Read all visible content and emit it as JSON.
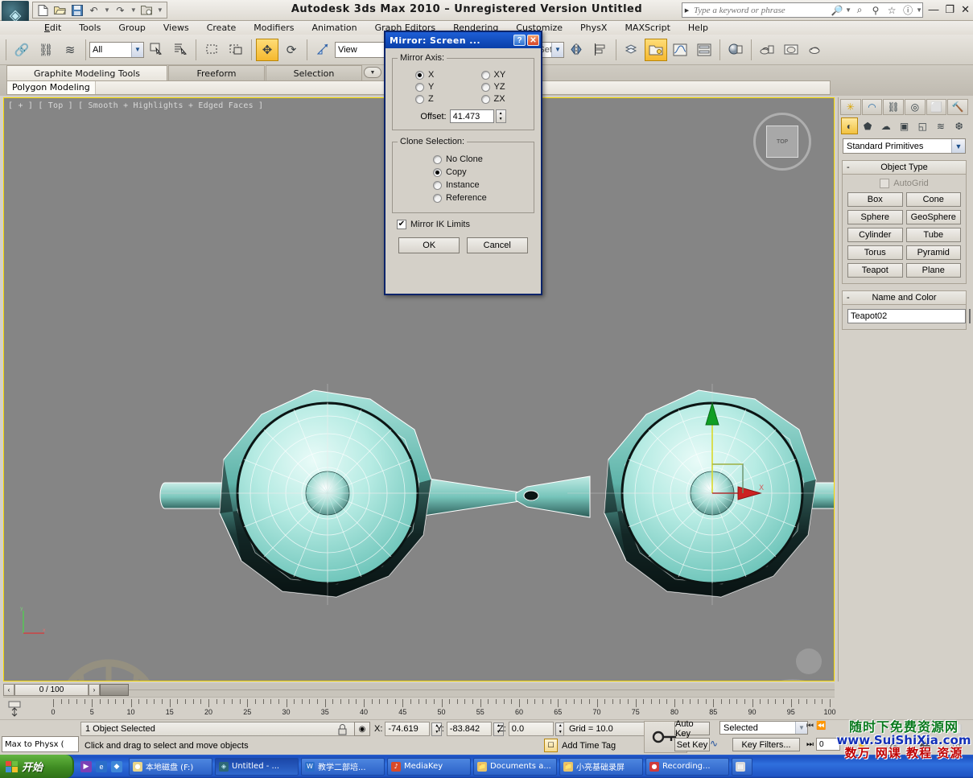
{
  "titlebar": {
    "app_title": "Autodesk 3ds Max  2010  – Unregistered Version  Untitled",
    "logo": "max-logo",
    "quick_access": [
      {
        "name": "new-file-icon",
        "glyph": "⬜"
      },
      {
        "name": "open-file-icon",
        "glyph": "🗁"
      },
      {
        "name": "save-file-icon",
        "glyph": "💾"
      },
      {
        "name": "undo-icon",
        "glyph": "↶"
      },
      {
        "name": "redo-icon",
        "glyph": "↷"
      },
      {
        "name": "project-folder-icon",
        "glyph": "🗂"
      }
    ],
    "search_placeholder": "Type a keyword or phrase",
    "search_value": "",
    "search_icons": [
      {
        "name": "binoculars-icon",
        "glyph": "🔎"
      },
      {
        "name": "magnifier-icon",
        "glyph": "⌕"
      },
      {
        "name": "communication-center-icon",
        "glyph": "☂"
      },
      {
        "name": "favorites-star-icon",
        "glyph": "☆"
      },
      {
        "name": "help-circle-icon",
        "glyph": "ⓘ"
      }
    ],
    "window_buttons": [
      {
        "name": "minimize-button",
        "glyph": "—"
      },
      {
        "name": "restore-button",
        "glyph": "❐"
      },
      {
        "name": "close-button",
        "glyph": "✕"
      }
    ]
  },
  "menubar": {
    "items": [
      {
        "label": "Edit",
        "accel": "E"
      },
      {
        "label": "Tools",
        "accel": "T"
      },
      {
        "label": "Group",
        "accel": "G"
      },
      {
        "label": "Views",
        "accel": "V"
      },
      {
        "label": "Create",
        "accel": "C"
      },
      {
        "label": "Modifiers",
        "accel": ""
      },
      {
        "label": "Animation",
        "accel": ""
      },
      {
        "label": "Graph Editors",
        "accel": ""
      },
      {
        "label": "Rendering",
        "accel": ""
      },
      {
        "label": "Customize",
        "accel": ""
      },
      {
        "label": "PhysX",
        "accel": ""
      },
      {
        "label": "MAXScript",
        "accel": "A"
      },
      {
        "label": "Help",
        "accel": "H"
      }
    ]
  },
  "toolbar": {
    "selection_filter_value": "All",
    "reference_coordinate_value": "View",
    "named_selection_set_placeholder": "Create Selection Set",
    "named_selection_set_value": "Create Selection Set",
    "buttons": [
      {
        "name": "select-and-link-icon",
        "glyph": "🔗"
      },
      {
        "name": "unlink-selection-icon",
        "glyph": "⛓"
      },
      {
        "name": "bind-to-space-warp-icon",
        "glyph": "≋"
      },
      {
        "name": "select-object-icon",
        "glyph": "⬚"
      },
      {
        "name": "select-by-name-icon",
        "glyph": "☰"
      },
      {
        "name": "rectangular-selection-region-icon",
        "glyph": "⬚"
      },
      {
        "name": "window-crossing-icon",
        "glyph": "◰"
      },
      {
        "name": "select-and-move-icon",
        "glyph": "✥"
      },
      {
        "name": "select-and-rotate-icon",
        "glyph": "↻"
      },
      {
        "name": "select-and-scale-icon",
        "glyph": "⤡"
      },
      {
        "name": "mirror-icon",
        "glyph": "◑"
      },
      {
        "name": "align-icon",
        "glyph": "⌸"
      },
      {
        "name": "layer-manager-icon",
        "glyph": "🗃"
      },
      {
        "name": "graphite-toggle-icon",
        "glyph": "🗀"
      },
      {
        "name": "curve-editor-icon",
        "glyph": "∿"
      },
      {
        "name": "schematic-view-icon",
        "glyph": "⬒"
      },
      {
        "name": "material-editor-icon",
        "glyph": "◕"
      },
      {
        "name": "render-setup-icon",
        "glyph": "⚒"
      },
      {
        "name": "rendered-frame-window-icon",
        "glyph": "⬜"
      },
      {
        "name": "render-production-icon",
        "glyph": "◔"
      }
    ]
  },
  "ribbon": {
    "tabs": [
      {
        "label": "Graphite Modeling Tools",
        "selected": true
      },
      {
        "label": "Freeform",
        "selected": false
      },
      {
        "label": "Selection",
        "selected": false
      }
    ],
    "dropdown_icon": "chevron-down-icon",
    "panel_label": "Polygon Modeling"
  },
  "viewport": {
    "label": "[ + ] [ Top ] [ Smooth + Highlights + Edged Faces ]",
    "viewcube_face": "TOP",
    "axis_labels": {
      "x": "x",
      "y": "y"
    }
  },
  "dialog": {
    "title": "Mirror: Screen ...",
    "help_button": "?",
    "close_button": "✕",
    "mirror_axis": {
      "legend": "Mirror Axis:",
      "options": [
        {
          "label": "X",
          "selected": true
        },
        {
          "label": "XY",
          "selected": false
        },
        {
          "label": "Y",
          "selected": false
        },
        {
          "label": "YZ",
          "selected": false
        },
        {
          "label": "Z",
          "selected": false
        },
        {
          "label": "ZX",
          "selected": false
        }
      ],
      "offset_label": "Offset:",
      "offset_value": "41.473"
    },
    "clone_selection": {
      "legend": "Clone Selection:",
      "options": [
        {
          "label": "No Clone",
          "selected": false
        },
        {
          "label": "Copy",
          "selected": true
        },
        {
          "label": "Instance",
          "selected": false
        },
        {
          "label": "Reference",
          "selected": false
        }
      ]
    },
    "mirror_ik_limits": {
      "label": "Mirror IK Limits",
      "checked": true,
      "mark": "✔"
    },
    "ok_label": "OK",
    "cancel_label": "Cancel"
  },
  "command_panel": {
    "tabs": [
      {
        "name": "create-tab",
        "glyph": "✳",
        "selected": false
      },
      {
        "name": "modify-tab",
        "glyph": "◠",
        "selected": true
      },
      {
        "name": "hierarchy-tab",
        "glyph": "⛓",
        "selected": false
      },
      {
        "name": "motion-tab",
        "glyph": "◎",
        "selected": false
      },
      {
        "name": "display-tab",
        "glyph": "⬜",
        "selected": false
      },
      {
        "name": "utilities-tab",
        "glyph": "🔨",
        "selected": false
      }
    ],
    "category_icons": [
      {
        "name": "geometry-icon",
        "glyph": "◐",
        "selected": true
      },
      {
        "name": "shapes-icon",
        "glyph": "⬟",
        "selected": false
      },
      {
        "name": "lights-icon",
        "glyph": "☁",
        "selected": false
      },
      {
        "name": "cameras-icon",
        "glyph": "🎥",
        "selected": false
      },
      {
        "name": "helpers-icon",
        "glyph": "◱",
        "selected": false
      },
      {
        "name": "space-warps-icon",
        "glyph": "≋",
        "selected": false
      },
      {
        "name": "systems-icon",
        "glyph": "❆",
        "selected": false
      }
    ],
    "primitive_category": "Standard Primitives",
    "object_type": {
      "header": "Object Type",
      "collapse": "-",
      "autogrid_label": "AutoGrid",
      "autogrid_checked": false,
      "buttons": [
        "Box",
        "Cone",
        "Sphere",
        "GeoSphere",
        "Cylinder",
        "Tube",
        "Torus",
        "Pyramid",
        "Teapot",
        "Plane"
      ]
    },
    "name_and_color": {
      "header": "Name and Color",
      "collapse": "-",
      "object_name": "Teapot02",
      "color": "#99e2dd"
    }
  },
  "time_slider": {
    "frame_display": "0 / 100",
    "prev_arrow": "‹",
    "next_arrow": "›"
  },
  "track_bar": {
    "ticks": [
      0,
      5,
      10,
      15,
      20,
      25,
      30,
      35,
      40,
      45,
      50,
      55,
      60,
      65,
      70,
      75,
      80,
      85,
      90,
      95,
      100
    ],
    "icon": "track-view-icon"
  },
  "status_bar": {
    "max_to_physx": "Max to Physx (",
    "selection_status": "1 Object Selected",
    "prompt": "Click and drag to select and move objects",
    "lock_icon": "lock-icon",
    "coord_icon": "absolute-mode-icon",
    "coords": [
      {
        "axis": "X:",
        "value": "-74.619"
      },
      {
        "axis": "Y:",
        "value": "-83.842"
      },
      {
        "axis": "Z:",
        "value": "0.0"
      }
    ],
    "grid_label": "Grid = 10.0",
    "add_time_tag": "Add Time Tag",
    "key_mode_icon": "key-mode-icon",
    "auto_key": "Auto Key",
    "set_key": "Set Key",
    "key_filters": "Key Filters...",
    "key_selection": "Selected",
    "frame_field": "0",
    "nav_icons": [
      {
        "name": "zoom-icon",
        "glyph": "⌕"
      },
      {
        "name": "zoom-all-icon",
        "glyph": "⊞"
      },
      {
        "name": "zoom-extents-icon",
        "glyph": "⬚"
      },
      {
        "name": "zoom-region-icon",
        "glyph": "⬜"
      },
      {
        "name": "pan-icon",
        "glyph": "✋"
      },
      {
        "name": "orbit-icon",
        "glyph": "↻"
      },
      {
        "name": "maximize-viewport-icon",
        "glyph": "⬛"
      },
      {
        "name": "field-of-view-icon",
        "glyph": "◳"
      }
    ],
    "playback": [
      {
        "name": "goto-start-icon",
        "glyph": "⏮"
      },
      {
        "name": "previous-frame-icon",
        "glyph": "⏪"
      },
      {
        "name": "play-icon",
        "glyph": "▶"
      },
      {
        "name": "next-frame-icon",
        "glyph": "⏩"
      },
      {
        "name": "goto-end-icon",
        "glyph": "⏭"
      }
    ],
    "time_config_icon": "time-configuration-icon"
  },
  "watermark": {
    "line1": "随时下免费资源网",
    "line2": "www.SuiShiXia.com",
    "line3": "数万 网课 教程 资源"
  },
  "taskbar": {
    "start_label": "开始",
    "quick_launch": [
      {
        "name": "media-player-icon",
        "glyph": "▶",
        "color": "#7b3fb5"
      },
      {
        "name": "ie-browser-icon",
        "glyph": "e",
        "color": "#2a6ec9"
      },
      {
        "name": "explorer-icon",
        "glyph": "◆",
        "color": "#3f87d8"
      }
    ],
    "tasks": [
      {
        "label": "本地磁盘 (F:)",
        "icon": "drive-icon",
        "color": "#e8d48a",
        "active": false
      },
      {
        "label": "Untitled - ...",
        "icon": "max-icon",
        "color": "#2d6877",
        "active": true
      },
      {
        "label": "教学二部培...",
        "icon": "word-icon",
        "color": "#2a6ec9",
        "active": false
      },
      {
        "label": "MediaKey",
        "icon": "mediakey-icon",
        "color": "#d84a2a",
        "active": false
      },
      {
        "label": "Documents a...",
        "icon": "folder-icon",
        "color": "#e8c468",
        "active": false
      },
      {
        "label": "小亮基础录屏",
        "icon": "folder-icon",
        "color": "#e8c468",
        "active": false
      },
      {
        "label": "Recording...",
        "icon": "recording-icon",
        "color": "#cf3b3b",
        "active": false
      },
      {
        "label": "",
        "icon": "window-icon",
        "color": "#dadada",
        "active": false
      }
    ]
  }
}
